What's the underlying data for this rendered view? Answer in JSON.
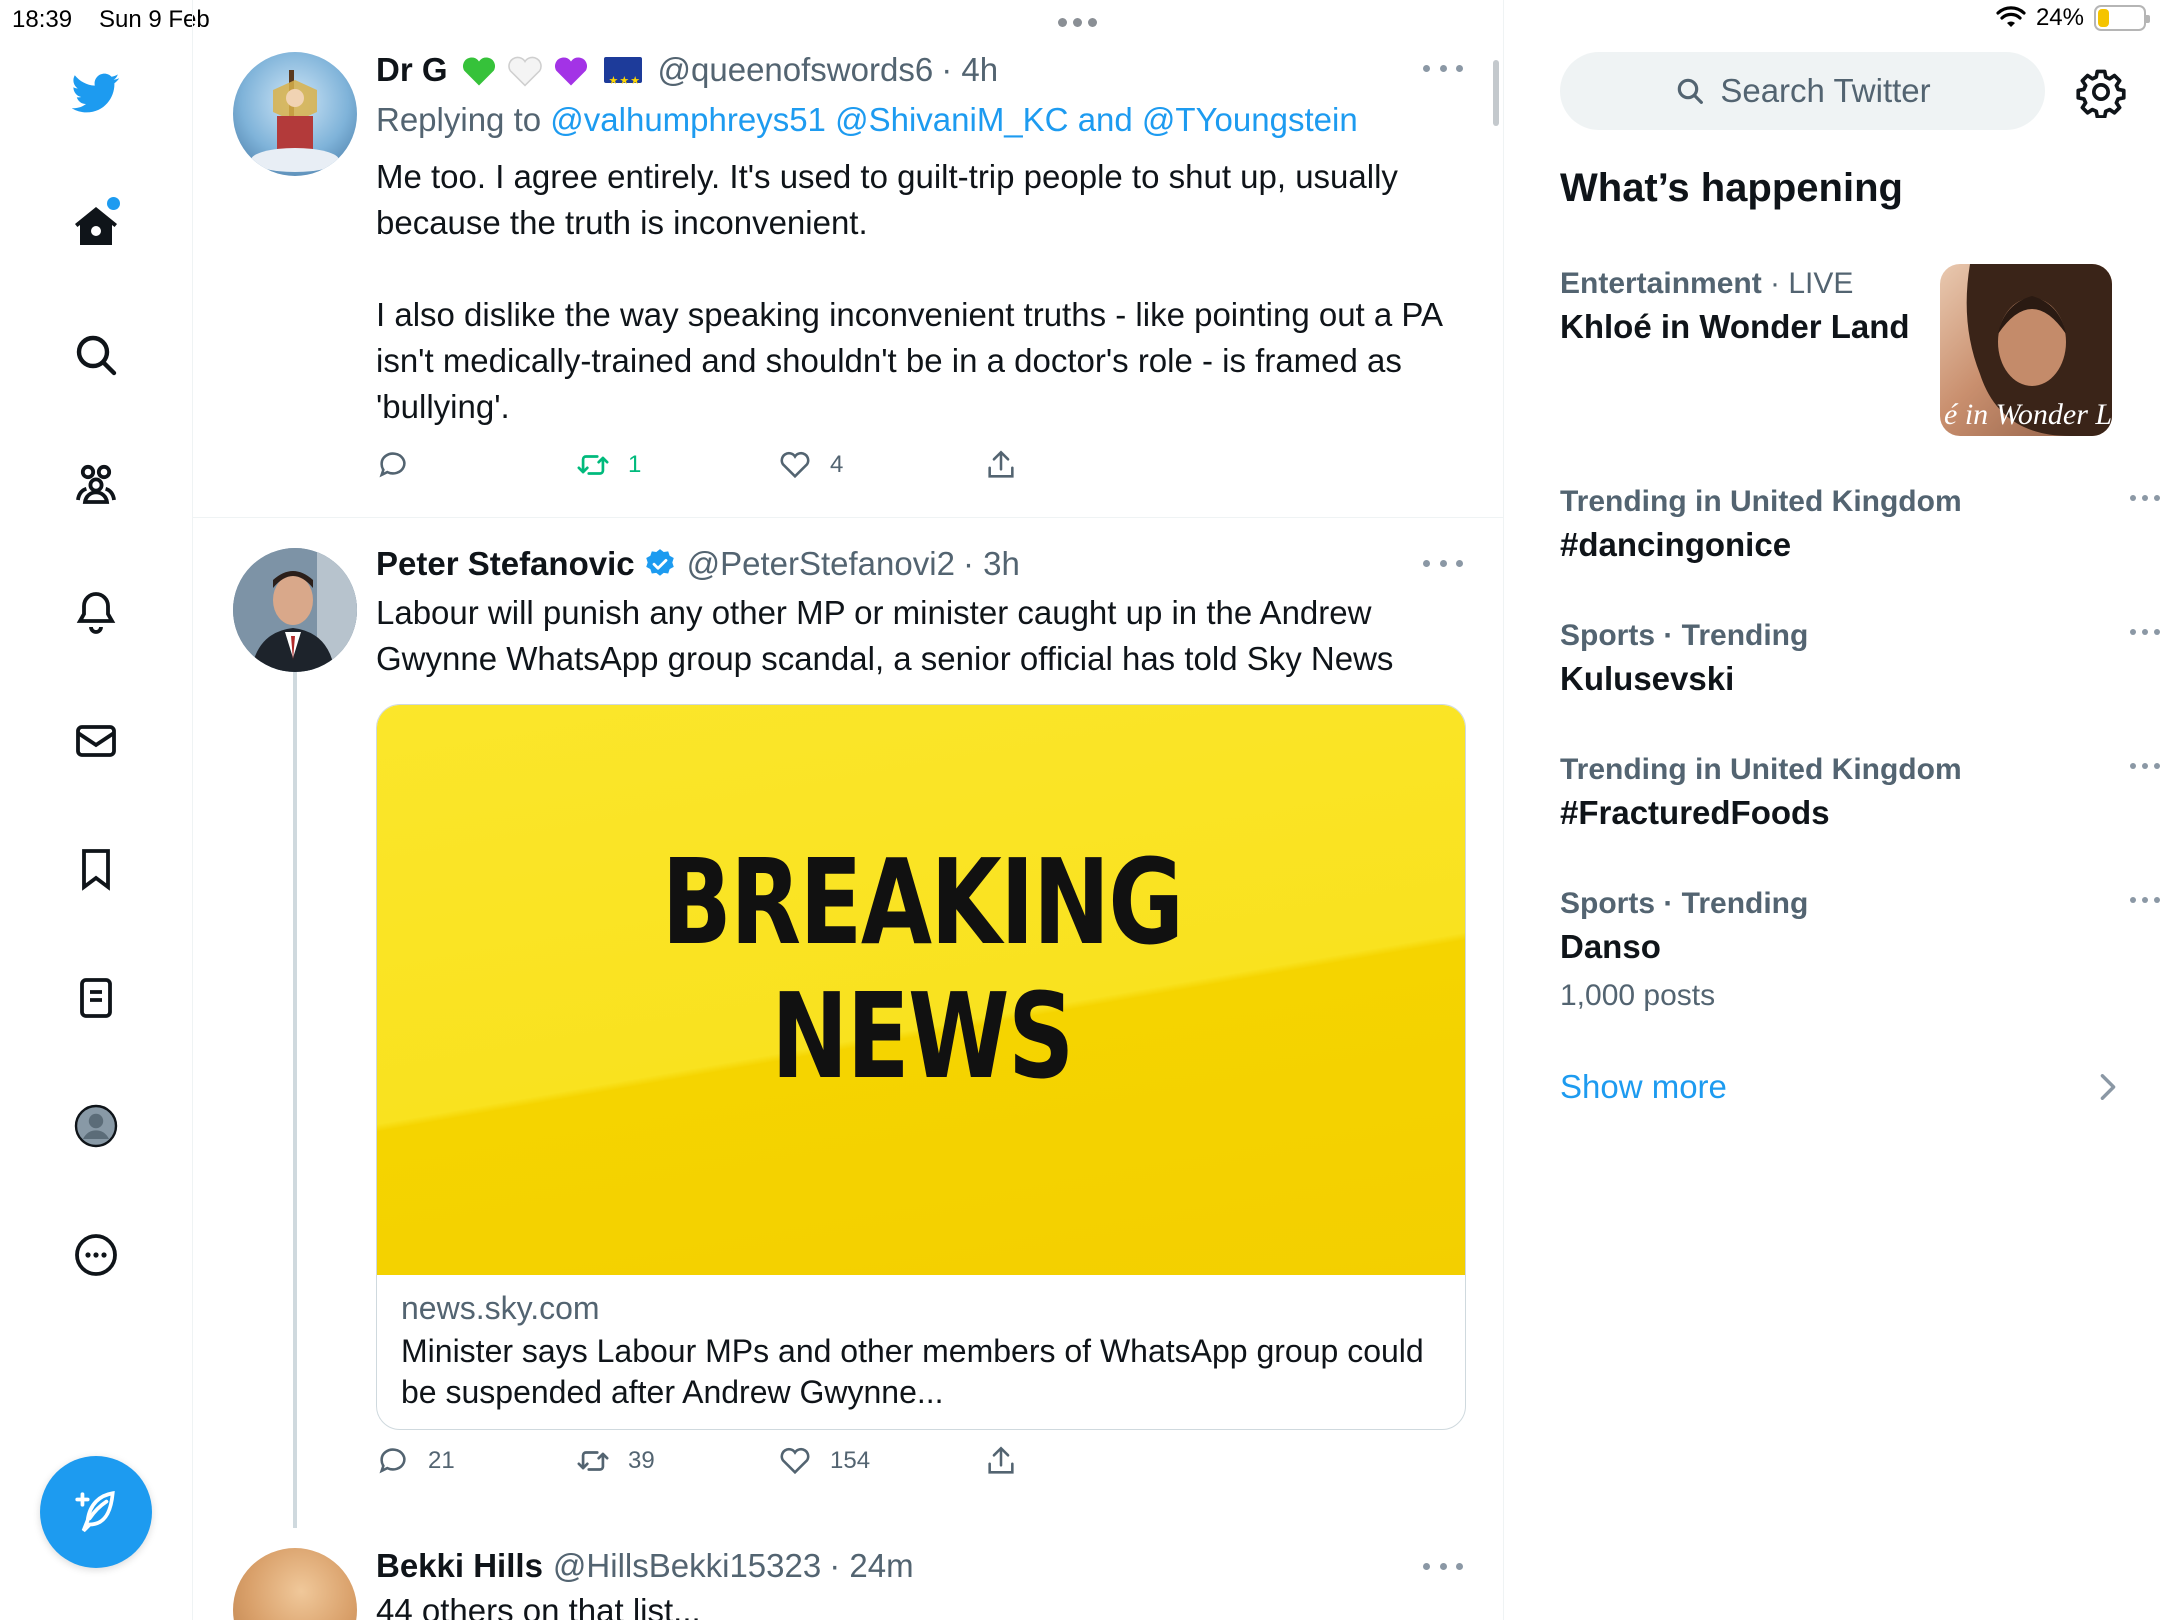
{
  "status_bar": {
    "time": "18:39",
    "date": "Sun 9 Feb",
    "battery": "24%",
    "battery_level": 0.24
  },
  "nav": {
    "items": [
      "home-icon",
      "search-icon",
      "communities-icon",
      "notifications-icon",
      "messages-icon",
      "bookmarks-icon",
      "lists-icon",
      "profile-icon",
      "more-icon"
    ],
    "accent": "#1d9bf0"
  },
  "tweets": [
    {
      "name": "Dr G",
      "emoji": [
        "green-heart",
        "white-heart",
        "purple-heart",
        "eu-flag"
      ],
      "handle": "@queenofswords6",
      "time": "· 4h",
      "replying_prefix": "Replying to",
      "replying_mentions": "@valhumphreys51 @ShivaniM_KC",
      "replying_and": "and",
      "replying_last": "@TYoungstein",
      "text_p1": "Me too. I agree entirely. It's used to guilt-trip people to shut up, usually because the truth is inconvenient.",
      "text_p2": "I also dislike the way speaking inconvenient truths - like pointing out a PA isn't medically-trained and shouldn't be in a doctor's role - is framed as 'bullying'.",
      "replies": "",
      "retweets": "1",
      "likes": "4"
    },
    {
      "name": "Peter Stefanovic",
      "verified": true,
      "handle": "@PeterStefanovi2",
      "time": "· 3h",
      "text": "Labour will punish any other MP or minister caught up in the Andrew Gwynne WhatsApp group scandal, a senior official has told Sky News",
      "card": {
        "image_line1": "BREAKING",
        "image_line2": "NEWS",
        "domain": "news.sky.com",
        "title": "Minister says Labour MPs and other members of WhatsApp group could be suspended after Andrew Gwynne..."
      },
      "replies": "21",
      "retweets": "39",
      "likes": "154"
    },
    {
      "name": "Bekki Hills",
      "handle": "@HillsBekki15323",
      "time": "· 24m",
      "text": "44 others on that list..."
    }
  ],
  "right": {
    "search_placeholder": "Search Twitter",
    "whats_happening": "What’s happening",
    "trends": [
      {
        "category": "Entertainment",
        "extra": "· LIVE",
        "name": "Khloé in Wonder Land",
        "posts": "",
        "thumb_text": "é in Wonder L"
      },
      {
        "category": "Trending in United Kingdom",
        "extra": "",
        "name": "#dancingonice",
        "posts": ""
      },
      {
        "category": "Sports · Trending",
        "extra": "",
        "name": "Kulusevski",
        "posts": ""
      },
      {
        "category": "Trending in United Kingdom",
        "extra": "",
        "name": "#FracturedFoods",
        "posts": ""
      },
      {
        "category": "Sports · Trending",
        "extra": "",
        "name": "Danso",
        "posts": "1,000 posts"
      }
    ],
    "show_more": "Show more"
  }
}
